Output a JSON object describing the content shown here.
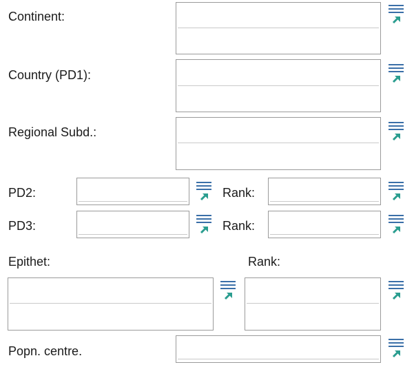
{
  "labels": {
    "continent": "Continent:",
    "country": "Country (PD1):",
    "regional": "Regional Subd.:",
    "pd2": "PD2:",
    "pd2_rank": "Rank:",
    "pd3": "PD3:",
    "pd3_rank": "Rank:",
    "epithet": "Epithet:",
    "epithet_rank": "Rank:",
    "popn_centre": "Popn. centre."
  },
  "fields": {
    "continent": "",
    "country": "",
    "regional": "",
    "pd2": "",
    "pd2_rank": "",
    "pd3": "",
    "pd3_rank": "",
    "epithet": "",
    "epithet_rank": "",
    "popn_centre": ""
  },
  "icons": {
    "picker": "list-pick-icon"
  },
  "colors": {
    "icon_lines": "#3a6fa8",
    "icon_arrow": "#2a9d8f",
    "border": "#9a9a9a"
  }
}
